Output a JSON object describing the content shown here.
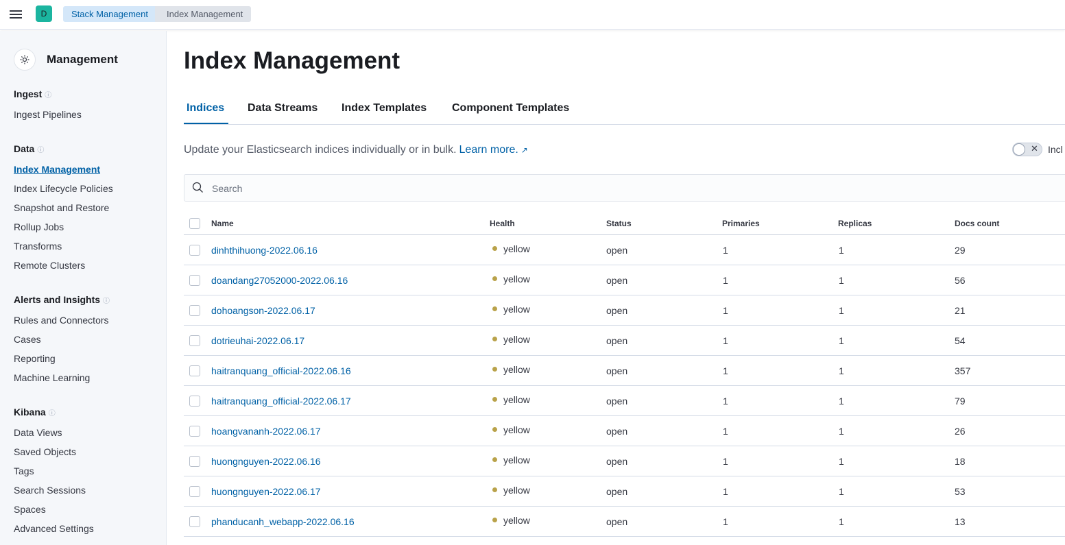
{
  "header": {
    "avatar_letter": "D",
    "breadcrumbs": [
      "Stack Management",
      "Index Management"
    ]
  },
  "sidebar": {
    "title": "Management",
    "groups": [
      {
        "title": "Ingest",
        "items": [
          "Ingest Pipelines"
        ]
      },
      {
        "title": "Data",
        "items": [
          "Index Management",
          "Index Lifecycle Policies",
          "Snapshot and Restore",
          "Rollup Jobs",
          "Transforms",
          "Remote Clusters"
        ]
      },
      {
        "title": "Alerts and Insights",
        "items": [
          "Rules and Connectors",
          "Cases",
          "Reporting",
          "Machine Learning"
        ]
      },
      {
        "title": "Kibana",
        "items": [
          "Data Views",
          "Saved Objects",
          "Tags",
          "Search Sessions",
          "Spaces",
          "Advanced Settings"
        ]
      }
    ],
    "active_item": "Index Management"
  },
  "main": {
    "title": "Index Management",
    "tabs": [
      "Indices",
      "Data Streams",
      "Index Templates",
      "Component Templates"
    ],
    "active_tab": "Indices",
    "description": "Update your Elasticsearch indices individually or in bulk.",
    "learn_more": "Learn more.",
    "toggle_label": "Incl",
    "search_placeholder": "Search"
  },
  "table": {
    "columns": [
      "Name",
      "Health",
      "Status",
      "Primaries",
      "Replicas",
      "Docs count"
    ],
    "rows": [
      {
        "name": "dinhthihuong-2022.06.16",
        "health": "yellow",
        "status": "open",
        "primaries": "1",
        "replicas": "1",
        "docs": "29"
      },
      {
        "name": "doandang27052000-2022.06.16",
        "health": "yellow",
        "status": "open",
        "primaries": "1",
        "replicas": "1",
        "docs": "56"
      },
      {
        "name": "dohoangson-2022.06.17",
        "health": "yellow",
        "status": "open",
        "primaries": "1",
        "replicas": "1",
        "docs": "21"
      },
      {
        "name": "dotrieuhai-2022.06.17",
        "health": "yellow",
        "status": "open",
        "primaries": "1",
        "replicas": "1",
        "docs": "54"
      },
      {
        "name": "haitranquang_official-2022.06.16",
        "health": "yellow",
        "status": "open",
        "primaries": "1",
        "replicas": "1",
        "docs": "357"
      },
      {
        "name": "haitranquang_official-2022.06.17",
        "health": "yellow",
        "status": "open",
        "primaries": "1",
        "replicas": "1",
        "docs": "79"
      },
      {
        "name": "hoangvananh-2022.06.17",
        "health": "yellow",
        "status": "open",
        "primaries": "1",
        "replicas": "1",
        "docs": "26"
      },
      {
        "name": "huongnguyen-2022.06.16",
        "health": "yellow",
        "status": "open",
        "primaries": "1",
        "replicas": "1",
        "docs": "18"
      },
      {
        "name": "huongnguyen-2022.06.17",
        "health": "yellow",
        "status": "open",
        "primaries": "1",
        "replicas": "1",
        "docs": "53"
      },
      {
        "name": "phanducanh_webapp-2022.06.16",
        "health": "yellow",
        "status": "open",
        "primaries": "1",
        "replicas": "1",
        "docs": "13"
      }
    ]
  },
  "colors": {
    "accent": "#0061a6",
    "health_yellow": "#b9a24a",
    "avatar_bg": "#1bb5a0"
  },
  "icons": {
    "menu": "hamburger-icon",
    "management": "gear-icon",
    "help": "question-circle-icon",
    "external": "external-link-icon",
    "search": "search-icon"
  }
}
